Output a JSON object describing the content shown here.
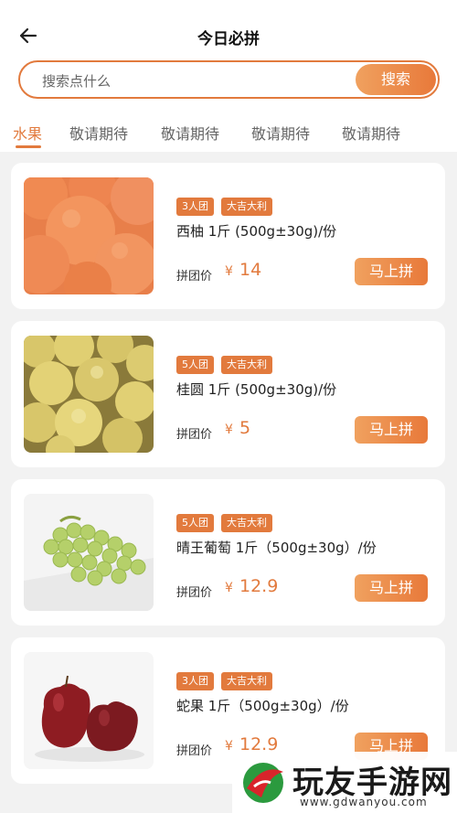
{
  "header": {
    "title": "今日必拼",
    "back_icon": "arrow-left-icon"
  },
  "search": {
    "placeholder": "搜索点什么",
    "button_label": "搜索"
  },
  "tabs": [
    {
      "label": "水果",
      "active": true
    },
    {
      "label": "敬请期待",
      "active": false
    },
    {
      "label": "敬请期待",
      "active": false
    },
    {
      "label": "敬请期待",
      "active": false
    },
    {
      "label": "敬请期待",
      "active": false
    }
  ],
  "products": [
    {
      "tags": [
        "3人团",
        "大吉大利"
      ],
      "name": "西柚 1斤 (500g±30g)/份",
      "price_label": "拼团价",
      "currency": "¥",
      "price": "14",
      "button": "马上拼",
      "image": "grapefruit-photo"
    },
    {
      "tags": [
        "5人团",
        "大吉大利"
      ],
      "name": "桂圆 1斤 (500g±30g)/份",
      "price_label": "拼团价",
      "currency": "¥",
      "price": "5",
      "button": "马上拼",
      "image": "longan-photo"
    },
    {
      "tags": [
        "5人团",
        "大吉大利"
      ],
      "name": "晴王葡萄 1斤（500g±30g）/份",
      "price_label": "拼团价",
      "currency": "¥",
      "price": "12.9",
      "button": "马上拼",
      "image": "green-grapes-photo"
    },
    {
      "tags": [
        "3人团",
        "大吉大利"
      ],
      "name": "蛇果 1斤（500g±30g）/份",
      "price_label": "拼团价",
      "currency": "¥",
      "price": "12.9",
      "button": "马上拼",
      "image": "red-apple-photo"
    }
  ],
  "watermark": {
    "text": "玩友手游网",
    "url": "www.gdwanyou.com"
  },
  "colors": {
    "accent": "#e27a3d",
    "page_bg": "#f2f2f2",
    "card_bg": "#ffffff"
  }
}
